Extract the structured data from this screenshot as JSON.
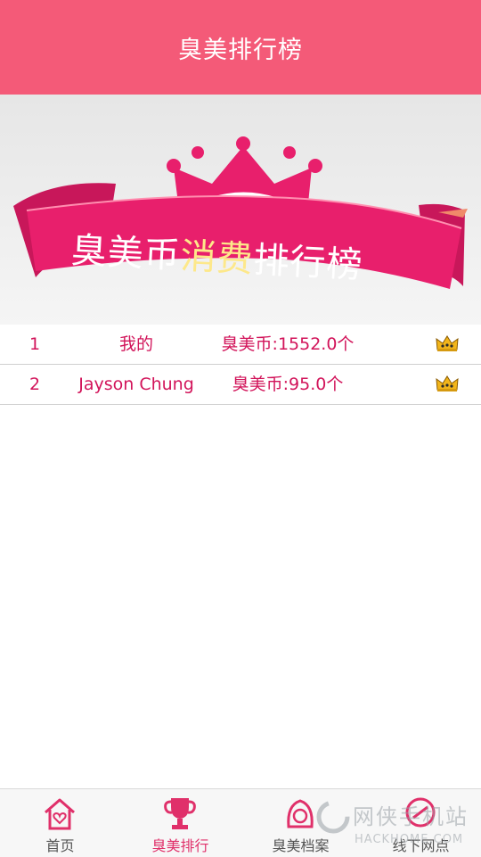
{
  "header": {
    "title": "臭美排行榜"
  },
  "banner": {
    "text_part1": "臭美币",
    "text_highlight": "消费",
    "text_part2": "排行榜",
    "colors": {
      "ribbon": "#e81f6c",
      "highlight": "#fde88a"
    }
  },
  "ranking": [
    {
      "rank": "1",
      "name": "我的",
      "coins": "臭美币:1552.0个",
      "icon": "crown-icon"
    },
    {
      "rank": "2",
      "name": "Jayson Chung",
      "coins": "臭美币:95.0个",
      "icon": "crown-icon"
    }
  ],
  "tabbar": {
    "items": [
      {
        "label": "首页",
        "icon": "home-icon",
        "active": false
      },
      {
        "label": "臭美排行",
        "icon": "trophy-icon",
        "active": true
      },
      {
        "label": "臭美档案",
        "icon": "profile-icon",
        "active": false
      },
      {
        "label": "线下网点",
        "icon": "location-icon",
        "active": false
      }
    ]
  },
  "watermark": {
    "text": "网侠手机站",
    "url": "HACKHOME.COM"
  },
  "colors": {
    "header": "#f45a78",
    "accent": "#d2145a",
    "tab_active": "#e0306a"
  }
}
